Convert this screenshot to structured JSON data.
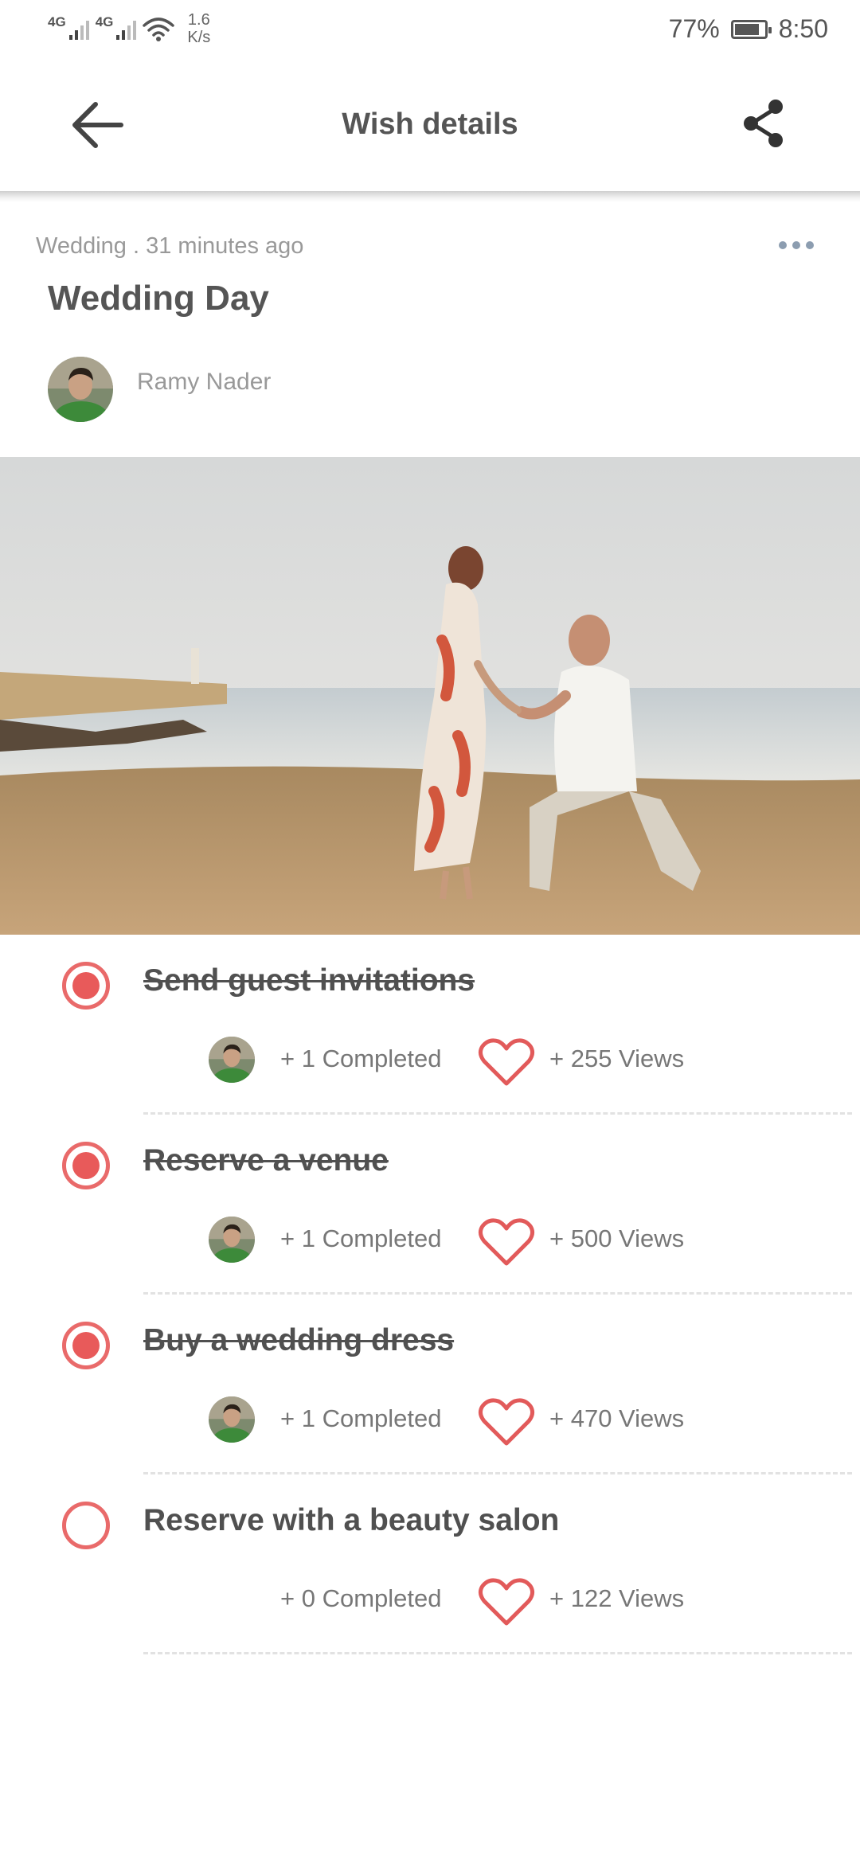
{
  "status_bar": {
    "network_1": "4G",
    "network_2": "4G",
    "speed_value": "1.6",
    "speed_unit": "K/s",
    "battery_percent": "77%",
    "battery_level": 0.77,
    "time": "8:50"
  },
  "app_bar": {
    "title": "Wish details",
    "back_icon": "arrow-left-icon",
    "share_icon": "share-icon"
  },
  "wish": {
    "category": "Wedding",
    "time_ago": ". 31 minutes ago",
    "more_icon": "more-horizontal-icon",
    "title": "Wedding Day",
    "author": "Ramy Nader"
  },
  "tasks": [
    {
      "title": "Send guest invitations",
      "done": true,
      "completed": "+ 1 Completed",
      "views": "+ 255 Views"
    },
    {
      "title": "Reserve a venue",
      "done": true,
      "completed": "+ 1 Completed",
      "views": "+ 500 Views"
    },
    {
      "title": "Buy a wedding dress",
      "done": true,
      "completed": "+ 1 Completed",
      "views": "+ 470 Views"
    },
    {
      "title": "Reserve with a beauty salon",
      "done": false,
      "completed": "+ 0 Completed",
      "views": "+ 122 Views"
    }
  ],
  "colors": {
    "accent": "#e85a5a",
    "text": "#555555",
    "muted": "#999999"
  }
}
